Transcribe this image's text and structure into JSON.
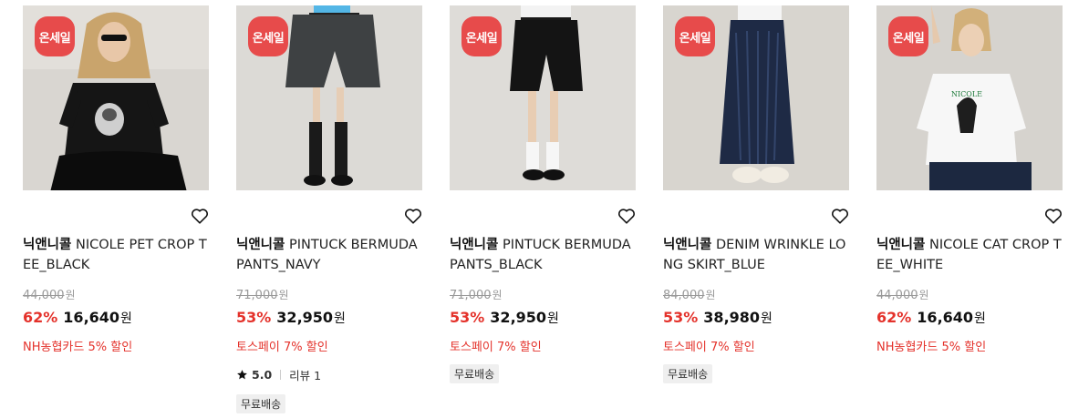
{
  "products": [
    {
      "badge": "온세일",
      "brand": "닉앤니콜",
      "name": " NICOLE PET CROP TEE_BLACK",
      "original_price": "44,000",
      "currency": "원",
      "discount": "62%",
      "price": "16,640",
      "promo": "NH농협카드 5% 할인",
      "rating_score": null,
      "review_label": null,
      "shipping_tag": null
    },
    {
      "badge": "온세일",
      "brand": "닉앤니콜",
      "name": " PINTUCK BERMUDA PANTS_NAVY",
      "original_price": "71,000",
      "currency": "원",
      "discount": "53%",
      "price": "32,950",
      "promo": "토스페이 7% 할인",
      "rating_score": "5.0",
      "review_label": "리뷰 1",
      "shipping_tag": "무료배송"
    },
    {
      "badge": "온세일",
      "brand": "닉앤니콜",
      "name": " PINTUCK BERMUDA PANTS_BLACK",
      "original_price": "71,000",
      "currency": "원",
      "discount": "53%",
      "price": "32,950",
      "promo": "토스페이 7% 할인",
      "rating_score": null,
      "review_label": null,
      "shipping_tag": "무료배송"
    },
    {
      "badge": "온세일",
      "brand": "닉앤니콜",
      "name": " DENIM WRINKLE LONG SKIRT_BLUE",
      "original_price": "84,000",
      "currency": "원",
      "discount": "53%",
      "price": "38,980",
      "promo": "토스페이 7% 할인",
      "rating_score": null,
      "review_label": null,
      "shipping_tag": "무료배송"
    },
    {
      "badge": "온세일",
      "brand": "닉앤니콜",
      "name": " NICOLE CAT CROP TEE_WHITE",
      "original_price": "44,000",
      "currency": "원",
      "discount": "62%",
      "price": "16,640",
      "promo": "NH농협카드 5% 할인",
      "rating_score": null,
      "review_label": null,
      "shipping_tag": null
    }
  ],
  "colors": {
    "badge_bg": "#e74b4b",
    "discount": "#e4322b",
    "promo": "#e4322b",
    "tag_bg": "#efefef"
  },
  "icons": {
    "wishlist": "heart-outline-icon",
    "rating": "star-icon"
  }
}
